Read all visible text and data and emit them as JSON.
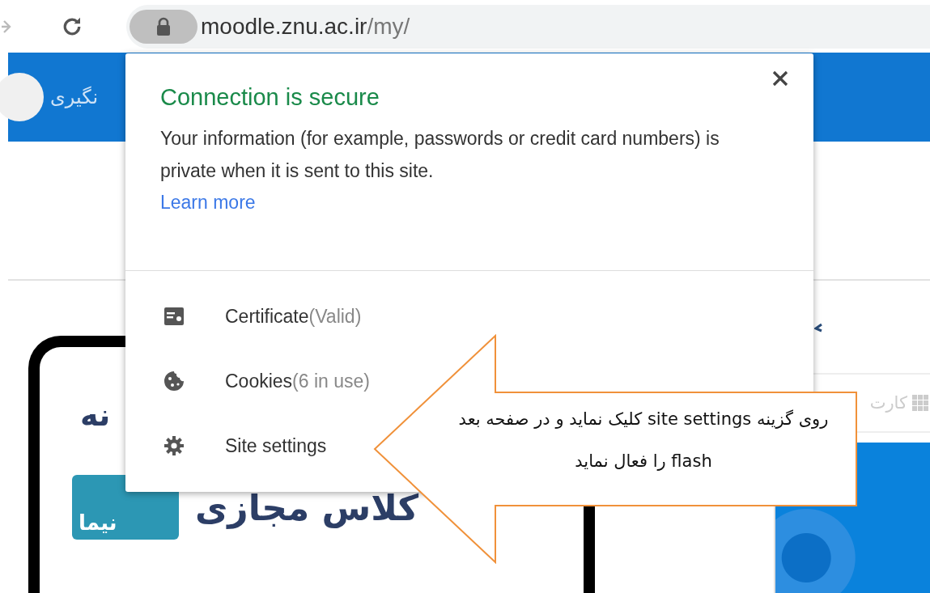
{
  "browser": {
    "url_host": "moodle.znu.ac.ir",
    "url_path": "/my/"
  },
  "page": {
    "header_user": "نگیری",
    "card_heading": "نه",
    "logo_text": "نیما",
    "logo_title": "کلاس مجازی",
    "tab_label": "کارت"
  },
  "popup": {
    "title": "Connection is secure",
    "description": "Your information (for example, passwords or credit card numbers) is private when it is sent to this site.",
    "link": "Learn more",
    "items": [
      {
        "kind": "certificate",
        "label": "Certificate",
        "detail": "(Valid)"
      },
      {
        "kind": "cookies",
        "label": "Cookies",
        "detail": "(6 in use)"
      },
      {
        "kind": "settings",
        "label": "Site settings"
      }
    ]
  },
  "callout": {
    "text": "روی گزینه  site settings کلیک نماید و در صفحه بعد  flash را فعال نماید"
  }
}
